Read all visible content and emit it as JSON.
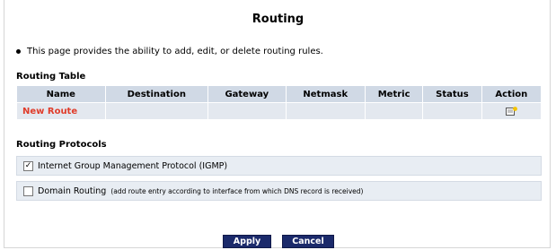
{
  "page": {
    "title": "Routing",
    "intro": "This page provides the ability to add, edit, or delete routing rules."
  },
  "routing_table": {
    "label": "Routing Table",
    "columns": [
      "Name",
      "Destination",
      "Gateway",
      "Netmask",
      "Metric",
      "Status",
      "Action"
    ],
    "rows": [
      {
        "name": "New Route",
        "destination": "",
        "gateway": "",
        "netmask": "",
        "metric": "",
        "status": "",
        "action_icon": "edit-add-icon"
      }
    ]
  },
  "routing_protocols": {
    "label": "Routing Protocols",
    "items": [
      {
        "label": "Internet Group Management Protocol (IGMP)",
        "note": "",
        "checked": true
      },
      {
        "label": "Domain Routing",
        "note": "(add route entry according to interface from which DNS record is received)",
        "checked": false
      }
    ]
  },
  "buttons": {
    "apply": "Apply",
    "cancel": "Cancel"
  },
  "colors": {
    "header_bg": "#d0d9e5",
    "row_bg": "#e3e8ef",
    "new_route": "#e03c2a",
    "button_bg": "#1b2a6b"
  }
}
